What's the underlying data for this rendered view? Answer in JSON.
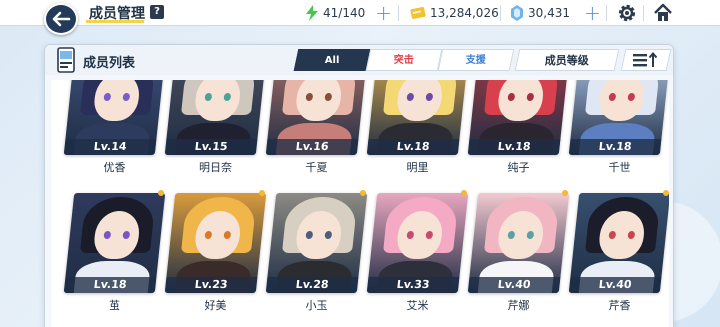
{
  "header": {
    "title": "成员管理",
    "help_label": "?",
    "ap": "41/140",
    "credits": "13,284,026",
    "pyroxene": "30,431"
  },
  "panel": {
    "title": "成员列表",
    "tabs": [
      {
        "label": "All"
      },
      {
        "label": "突击"
      },
      {
        "label": "支援"
      }
    ],
    "sort_label": "成员等级"
  },
  "members_row1": [
    {
      "name": "优香",
      "level": "Lv.14",
      "hair": "#2a2f5a",
      "body": "#2d3b5e",
      "eye": "#7b5cc9",
      "bg": "#3c4f7a"
    },
    {
      "name": "明日奈",
      "level": "Lv.15",
      "hair": "#cfc7be",
      "body": "#1f2030",
      "eye": "#4aa39b",
      "bg": "#4a4e5c"
    },
    {
      "name": "千夏",
      "level": "Lv.16",
      "hair": "#e6b5a7",
      "body": "#c67f78",
      "eye": "#8a4f3a",
      "bg": "#a56e66"
    },
    {
      "name": "明里",
      "level": "Lv.18",
      "hair": "#f3d873",
      "body": "#2a2b33",
      "eye": "#6c4aa6",
      "bg": "#cfa54c"
    },
    {
      "name": "纯子",
      "level": "Lv.18",
      "hair": "#d8404d",
      "body": "#2b2530",
      "eye": "#a63040",
      "bg": "#9e3a46"
    },
    {
      "name": "千世",
      "level": "Lv.18",
      "hair": "#dfe7f5",
      "body": "#5b7fc0",
      "eye": "#c33b58",
      "bg": "#a9bfe0"
    }
  ],
  "members_row2": [
    {
      "name": "茧",
      "level": "Lv.18",
      "hair": "#1a1c2a",
      "body": "#e9eef6",
      "eye": "#7a56c4",
      "bg": "#2f3a5d"
    },
    {
      "name": "好美",
      "level": "Lv.23",
      "hair": "#f0b64a",
      "body": "#3a2a2a",
      "eye": "#d87a2a",
      "bg": "#d89b3c"
    },
    {
      "name": "小玉",
      "level": "Lv.28",
      "hair": "#d7d0c2",
      "body": "#2a2c30",
      "eye": "#4e5d7a",
      "bg": "#8c8a84"
    },
    {
      "name": "艾米",
      "level": "Lv.33",
      "hair": "#f4a9c4",
      "body": "#2d2f3a",
      "eye": "#c84a6d",
      "bg": "#e7a7bf"
    },
    {
      "name": "芹娜",
      "level": "Lv.40",
      "hair": "#f2b6c2",
      "body": "#f6f6f8",
      "eye": "#5ca0a4",
      "bg": "#f3c9d1"
    },
    {
      "name": "芹香",
      "level": "Lv.40",
      "hair": "#1c1d2a",
      "body": "#e9edf6",
      "eye": "#c84652",
      "bg": "#37506f"
    }
  ]
}
